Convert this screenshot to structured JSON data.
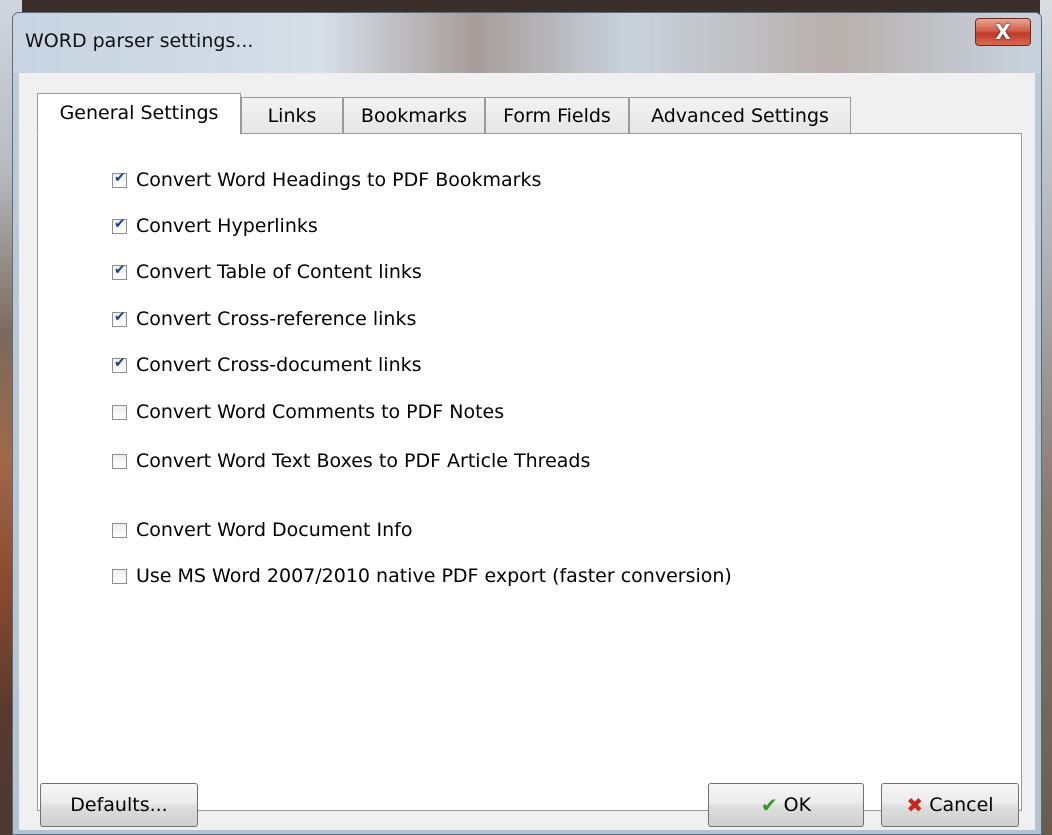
{
  "window": {
    "title": "WORD parser settings...",
    "close_glyph": "X"
  },
  "tabs": [
    {
      "label": "General Settings",
      "active": true
    },
    {
      "label": "Links",
      "active": false
    },
    {
      "label": "Bookmarks",
      "active": false
    },
    {
      "label": "Form Fields",
      "active": false
    },
    {
      "label": "Advanced Settings",
      "active": false
    }
  ],
  "options": [
    {
      "label": "Convert Word Headings to PDF Bookmarks",
      "checked": true
    },
    {
      "label": "Convert Hyperlinks",
      "checked": true
    },
    {
      "label": "Convert Table of Content links",
      "checked": true
    },
    {
      "label": "Convert Cross-reference links",
      "checked": true
    },
    {
      "label": "Convert Cross-document links",
      "checked": true
    },
    {
      "label": "Convert Word Comments to PDF Notes",
      "checked": false
    },
    {
      "label": "Convert Word Text Boxes to PDF Article Threads",
      "checked": false
    },
    {
      "label": "Convert Word Document Info",
      "checked": false
    },
    {
      "label": "Use MS Word 2007/2010 native PDF export (faster conversion)",
      "checked": false
    }
  ],
  "buttons": {
    "defaults": "Defaults...",
    "ok": "OK",
    "cancel": "Cancel"
  }
}
